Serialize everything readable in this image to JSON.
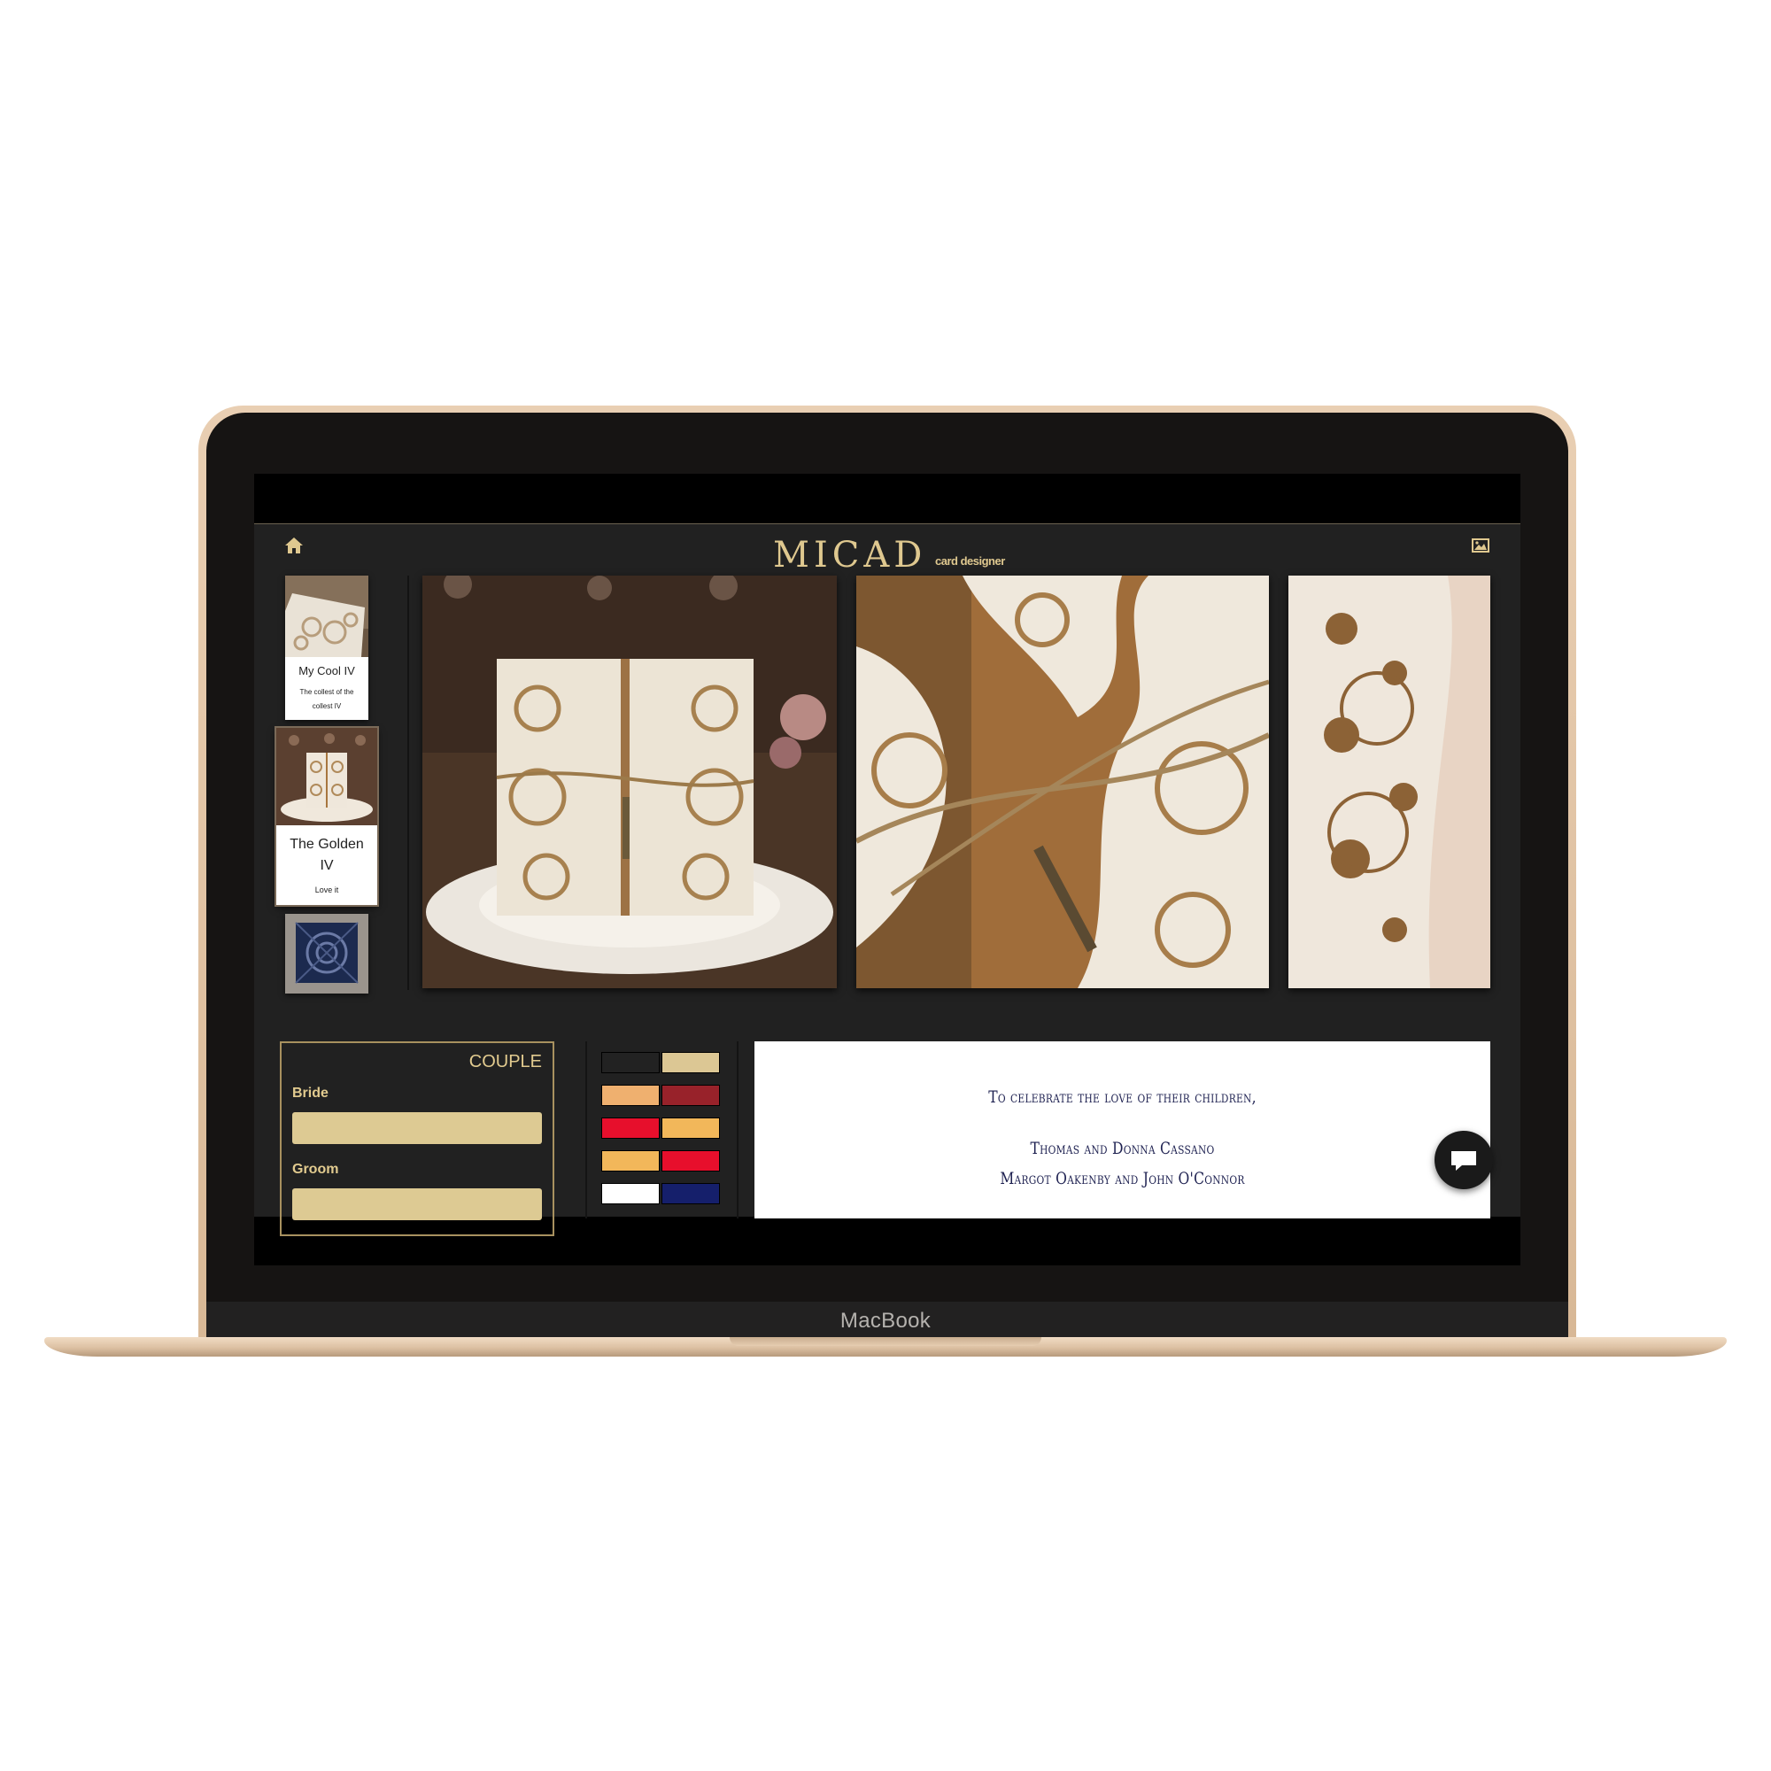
{
  "device": {
    "brand_label": "MacBook"
  },
  "header": {
    "logo": "MICAD",
    "logo_subtitle": "card designer",
    "home_icon": "home-icon",
    "gallery_icon": "image-icon"
  },
  "sidebar": {
    "items": [
      {
        "title": "My Cool IV",
        "description": "The collest of the collest IV",
        "selected": false
      },
      {
        "title": "The Golden IV",
        "description": "Love it",
        "selected": true
      },
      {
        "title": "",
        "description": "",
        "selected": false
      }
    ]
  },
  "photos": [
    {
      "alt": "laser-cut invitation on plate"
    },
    {
      "alt": "invitation close-up with twine and key"
    },
    {
      "alt": "lace detail close-up"
    }
  ],
  "couple_form": {
    "title": "COUPLE",
    "bride_label": "Bride",
    "bride_value": "",
    "groom_label": "Groom",
    "groom_value": ""
  },
  "palette": [
    {
      "left": "#222222",
      "right": "#dcc794"
    },
    {
      "left": "#efb06f",
      "right": "#98222a"
    },
    {
      "left": "#e70f2c",
      "right": "#f2b75a"
    },
    {
      "left": "#f2b75a",
      "right": "#e70f2c"
    },
    {
      "left": "#ffffff",
      "right": "#151f6b"
    }
  ],
  "preview": {
    "line1": "To celebrate the love of their children,",
    "line2": "Thomas and Donna Cassano",
    "line3": "Margot Oakenby and John O'Connor"
  },
  "chat": {
    "icon": "chat-icon"
  },
  "colors": {
    "accent_gold": "#dfc88f",
    "app_bg": "#212121"
  }
}
